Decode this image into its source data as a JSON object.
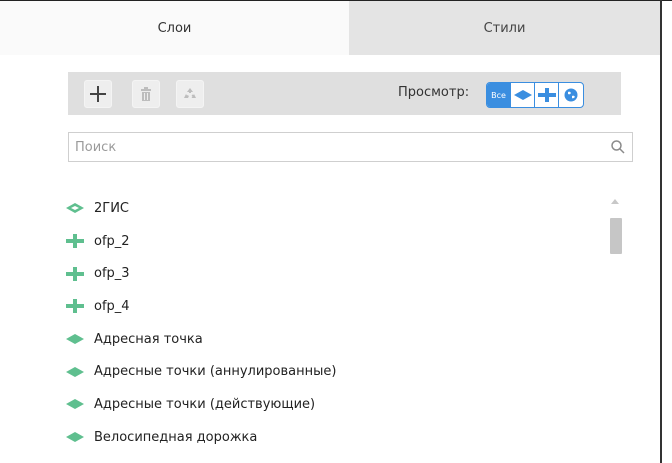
{
  "tabs": [
    {
      "label": "Слои",
      "active": true
    },
    {
      "label": "Стили",
      "active": false
    }
  ],
  "toolbar": {
    "add_icon": "plus-icon",
    "delete_icon": "trash-icon",
    "recycle_icon": "recycle-icon",
    "view_label": "Просмотр:",
    "view_all_label": "Все",
    "view_options": [
      "all",
      "polygon",
      "line",
      "globe"
    ]
  },
  "search": {
    "placeholder": "Поиск",
    "icon": "search-icon"
  },
  "layers": [
    {
      "label": "2ГИС",
      "icon": "polygon-layer-icon"
    },
    {
      "label": "ofp_2",
      "icon": "line-layer-icon"
    },
    {
      "label": "ofp_3",
      "icon": "line-layer-icon"
    },
    {
      "label": "ofp_4",
      "icon": "line-layer-icon"
    },
    {
      "label": "Адресная точка",
      "icon": "polygon-layer-icon"
    },
    {
      "label": "Адресные точки (аннулированные)",
      "icon": "polygon-layer-icon"
    },
    {
      "label": "Адресные точки (действующие)",
      "icon": "polygon-layer-icon"
    },
    {
      "label": "Велосипедная дорожка",
      "icon": "polygon-layer-icon"
    }
  ],
  "colors": {
    "accent": "#3a8ee0",
    "layer_icon": "#5fbf8f",
    "toolbar_bg": "#dfdfdf",
    "inactive_tab_bg": "#e4e4e4"
  }
}
